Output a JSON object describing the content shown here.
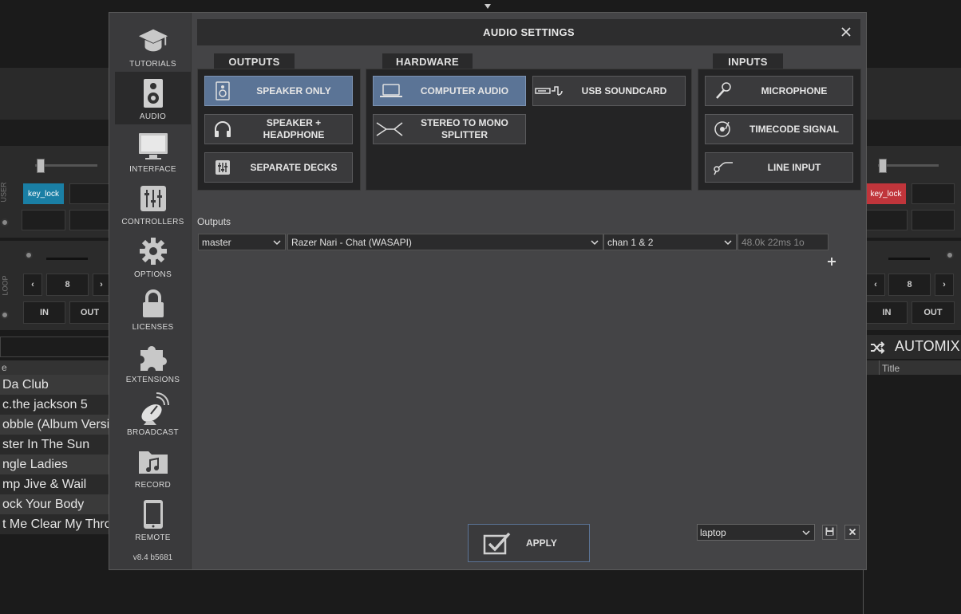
{
  "background": {
    "left_deck": {
      "user_label": "USER",
      "keylock_label": "key_lock",
      "loop_label": "LOOP",
      "loop_value": "8",
      "in_label": "IN",
      "out_label": "OUT",
      "keylock_color": "#1a7fa5"
    },
    "right_deck": {
      "keylock_label": "key_lock",
      "loop_value": "8",
      "in_label": "IN",
      "out_label": "OUT",
      "keylock_color": "#c0353b"
    },
    "browser": {
      "column_header": "e",
      "rows": [
        "Da Club",
        "c.the jackson 5",
        "obble (Album Versi",
        "ster In The Sun",
        "ngle Ladies",
        "mp Jive & Wail",
        "ock Your Body",
        "t Me Clear My Thro"
      ]
    },
    "automix": {
      "label": "AUTOMIX",
      "column_title": "Title"
    }
  },
  "dialog": {
    "title": "AUDIO SETTINGS",
    "version": "v8.4 b5681",
    "sidebar": [
      {
        "label": "TUTORIALS",
        "icon": "graduation-cap-icon"
      },
      {
        "label": "AUDIO",
        "icon": "speaker-icon"
      },
      {
        "label": "INTERFACE",
        "icon": "monitor-icon"
      },
      {
        "label": "CONTROLLERS",
        "icon": "sliders-icon"
      },
      {
        "label": "OPTIONS",
        "icon": "gear-icon"
      },
      {
        "label": "LICENSES",
        "icon": "lock-icon"
      },
      {
        "label": "EXTENSIONS",
        "icon": "puzzle-icon"
      },
      {
        "label": "BROADCAST",
        "icon": "satellite-dish-icon"
      },
      {
        "label": "RECORD",
        "icon": "music-folder-icon"
      },
      {
        "label": "REMOTE",
        "icon": "tablet-icon"
      }
    ],
    "active_item": "AUDIO",
    "tabs": {
      "outputs": "OUTPUTS",
      "hardware": "HARDWARE",
      "inputs": "INPUTS"
    },
    "outputs_options": [
      {
        "label": "SPEAKER ONLY",
        "icon": "speaker-icon",
        "selected": true
      },
      {
        "label": "SPEAKER + HEADPHONE",
        "icon": "headphones-icon",
        "selected": false
      },
      {
        "label": "SEPARATE DECKS",
        "icon": "mixer-icon",
        "selected": false
      }
    ],
    "hardware_options": [
      {
        "label": "COMPUTER AUDIO",
        "icon": "laptop-icon",
        "selected": true
      },
      {
        "label": "USB SOUNDCARD",
        "icon": "usb-soundcard-icon",
        "selected": false
      },
      {
        "label": "STEREO TO MONO SPLITTER",
        "icon": "splitter-cable-icon",
        "selected": false
      }
    ],
    "inputs_options": [
      {
        "label": "MICROPHONE",
        "icon": "microphone-icon",
        "selected": false
      },
      {
        "label": "TIMECODE SIGNAL",
        "icon": "turntable-icon",
        "selected": false
      },
      {
        "label": "LINE INPUT",
        "icon": "line-cable-icon",
        "selected": false
      }
    ],
    "outputs_section": {
      "label": "Outputs",
      "channel_select": "master",
      "device_select": "Razer Nari - Chat (WASAPI)",
      "chan_select": "chan 1 & 2",
      "info": "48.0k 22ms 1o",
      "add_label": "+"
    },
    "apply_label": "APPLY",
    "preset_select": "laptop",
    "selected_color": "#5b7496"
  }
}
